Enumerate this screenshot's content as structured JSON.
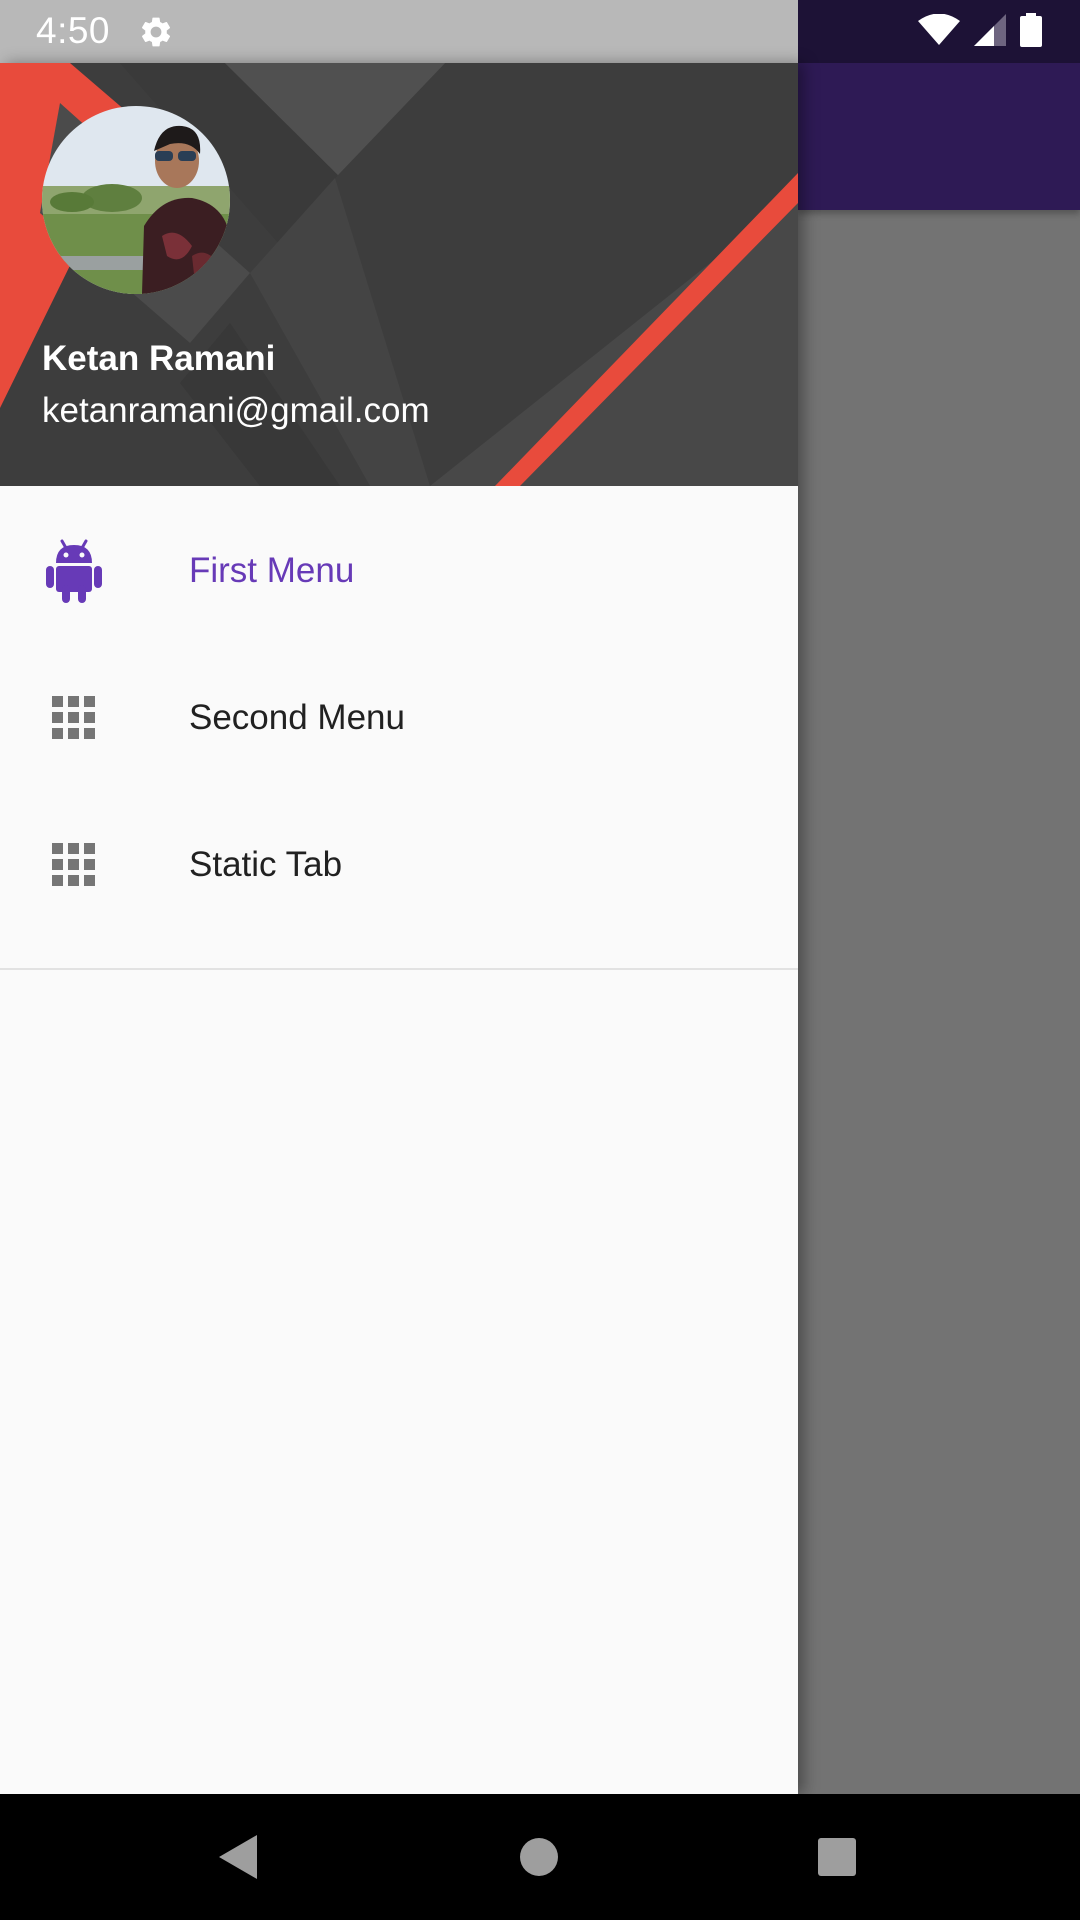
{
  "status_bar": {
    "time": "4:50",
    "icons": [
      "gear-icon",
      "wifi-icon",
      "signal-icon",
      "battery-icon"
    ]
  },
  "drawer": {
    "header": {
      "user_name": "Ketan Ramani",
      "user_email": "ketanramani@gmail.com",
      "avatar": "profile-photo"
    },
    "menu": [
      {
        "label": "First Menu",
        "icon": "android-icon",
        "selected": true
      },
      {
        "label": "Second Menu",
        "icon": "grid-icon",
        "selected": false
      },
      {
        "label": "Static Tab",
        "icon": "grid-icon",
        "selected": false
      }
    ]
  },
  "nav_bar": {
    "buttons": [
      "back",
      "home",
      "recents"
    ]
  },
  "colors": {
    "accent": "#673ab7",
    "header_bg": "#3d3d3d",
    "header_stripe": "#e84b3c",
    "toolbar": "#2e1a55",
    "status_bar_app": "#1d1236"
  }
}
